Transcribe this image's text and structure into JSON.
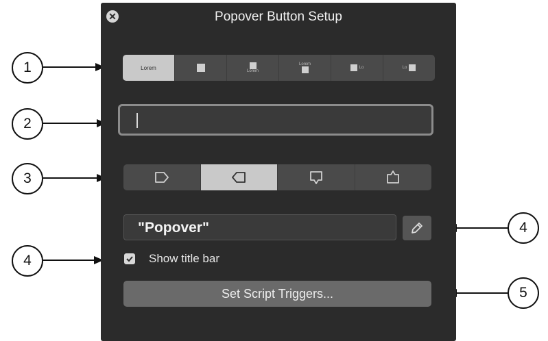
{
  "dialog": {
    "title": "Popover Button Setup",
    "close_icon": "close-icon"
  },
  "label_position_options": [
    {
      "label": "Lorem",
      "active": true
    },
    {
      "label": "",
      "active": false
    },
    {
      "label": "Lorem",
      "active": false
    },
    {
      "label": "Lorem",
      "active": false
    },
    {
      "label": "Lo",
      "active": false
    },
    {
      "label": "Lo",
      "active": false
    }
  ],
  "popover_direction_options": [
    {
      "icon": "popover-right-icon",
      "active": false
    },
    {
      "icon": "popover-left-icon",
      "active": true
    },
    {
      "icon": "popover-down-icon",
      "active": false
    },
    {
      "icon": "popover-up-icon",
      "active": false
    }
  ],
  "label_field": {
    "value": ""
  },
  "name_field": {
    "value": "\"Popover\"",
    "edit_icon": "pencil-icon"
  },
  "show_title_bar": {
    "label": "Show title bar",
    "checked": true
  },
  "script_triggers_button": {
    "label": "Set Script Triggers..."
  },
  "callouts": {
    "c1": "1",
    "c2": "2",
    "c3": "3",
    "c4a": "4",
    "c4b": "4",
    "c5": "5"
  }
}
